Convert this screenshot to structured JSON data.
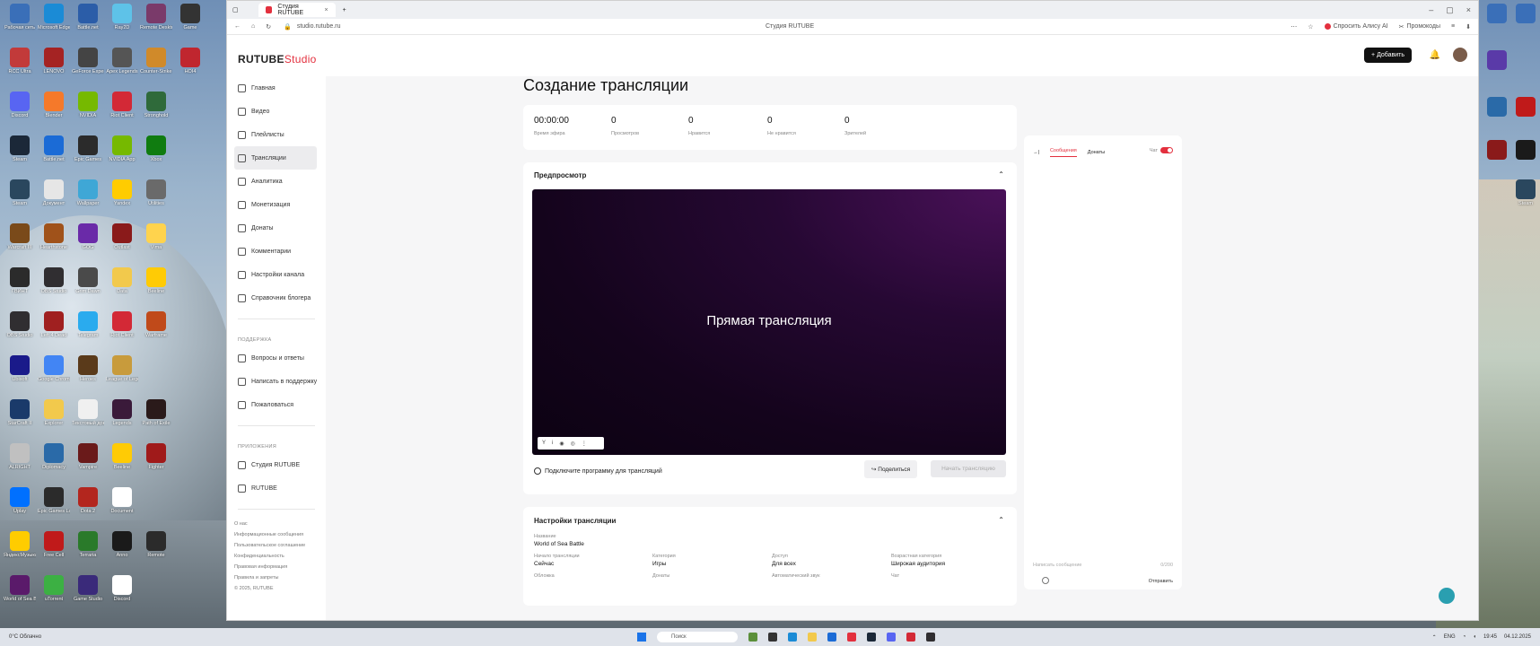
{
  "desktop": {
    "icons_left": [
      {
        "label": "Рабочая сеть",
        "color": "#3a6fb8"
      },
      {
        "label": "Microsoft Edge",
        "color": "#1b8bd6"
      },
      {
        "label": "Battle.net",
        "color": "#2b5da8"
      },
      {
        "label": "Ray2D",
        "color": "#5ec2e8"
      },
      {
        "label": "Remote Desktop",
        "color": "#7a3a6a"
      },
      {
        "label": "Game",
        "color": "#333"
      },
      {
        "label": "RCC Ultra",
        "color": "#c23a3a"
      },
      {
        "label": "LENOVO",
        "color": "#a52323"
      },
      {
        "label": "GeForce Experience",
        "color": "#444"
      },
      {
        "label": "Apex Legends",
        "color": "#555"
      },
      {
        "label": "Counter-Strike 2",
        "color": "#d08a2a"
      },
      {
        "label": "HOI4",
        "color": "#c0262f"
      },
      {
        "label": "Discord",
        "color": "#5865f2"
      },
      {
        "label": "Blender",
        "color": "#f5792a"
      },
      {
        "label": "NVIDIA",
        "color": "#76b900"
      },
      {
        "label": "Riot Client",
        "color": "#d32936"
      },
      {
        "label": "Stronghold",
        "color": "#2f6a3a"
      },
      {
        "label": "Steam",
        "color": "#1b2838"
      },
      {
        "label": "Battle.net",
        "color": "#1b6bd6"
      },
      {
        "label": "Epic Games",
        "color": "#2b2b2b"
      },
      {
        "label": "NVIDIA App",
        "color": "#76b900"
      },
      {
        "label": "Xbox",
        "color": "#107c10"
      },
      {
        "label": "Steam",
        "color": "#2a475e"
      },
      {
        "label": "Документ",
        "color": "#e6e6e6"
      },
      {
        "label": "Wallpaper",
        "color": "#3fa7d6"
      },
      {
        "label": "Yandex",
        "color": "#ffcc00"
      },
      {
        "label": "Utilities",
        "color": "#6a6a6a"
      },
      {
        "label": "Warcraft III",
        "color": "#7a4a1a"
      },
      {
        "label": "Hearthstone",
        "color": "#a0521a"
      },
      {
        "label": "GOG",
        "color": "#6a2aa8"
      },
      {
        "label": "Outlast",
        "color": "#8a1a1a"
      },
      {
        "label": "Vima",
        "color": "#ffd34d"
      },
      {
        "label": "ГВИНТ",
        "color": "#2b2b2b"
      },
      {
        "label": "OBS Studio",
        "color": "#302e31"
      },
      {
        "label": "Grim Dawn",
        "color": "#4a4a4a"
      },
      {
        "label": "Data",
        "color": "#f2c94c"
      },
      {
        "label": "Beeline",
        "color": "#ffcb05"
      },
      {
        "label": "OBS Studio",
        "color": "#302e31"
      },
      {
        "label": "Left 4 Dead",
        "color": "#a02020"
      },
      {
        "label": "Telegram",
        "color": "#2aabee"
      },
      {
        "label": "Riot Client",
        "color": "#d32936"
      },
      {
        "label": "Warframe",
        "color": "#c04a1a"
      },
      {
        "label": "Ubisoft",
        "color": "#1a1a8a"
      },
      {
        "label": "Google Chrome",
        "color": "#4285f4"
      },
      {
        "label": "Heroes",
        "color": "#5a3a1a"
      },
      {
        "label": "League of Legends",
        "color": "#c89b3c"
      },
      {
        "label": "StarCraft II",
        "color": "#1a3a6a"
      },
      {
        "label": "Explorer",
        "color": "#f2c94c"
      },
      {
        "label": "Текстовый документ",
        "color": "#f0f0f0"
      },
      {
        "label": "Legends",
        "color": "#3a1a3a"
      },
      {
        "label": "Path of Exile",
        "color": "#2a1a1a"
      },
      {
        "label": "ALRIGHT",
        "color": "#c0c0c0"
      },
      {
        "label": "Diplomacy",
        "color": "#2a6aa8"
      },
      {
        "label": "Vampire",
        "color": "#6a1a1a"
      },
      {
        "label": "Beeline",
        "color": "#ffcb05"
      },
      {
        "label": "Fighter",
        "color": "#a01a1a"
      },
      {
        "label": "Uplay",
        "color": "#0070ff"
      },
      {
        "label": "Epic Games Launcher",
        "color": "#2b2b2b"
      },
      {
        "label": "Dota 2",
        "color": "#b3261e"
      },
      {
        "label": "Document",
        "color": "#fff"
      },
      {
        "label": "ЯндексМузыка",
        "color": "#ffcc00"
      },
      {
        "label": "Free Cell",
        "color": "#c01a1a"
      },
      {
        "label": "Terraria",
        "color": "#2a7a2a"
      },
      {
        "label": "Anno",
        "color": "#1a1a1a"
      },
      {
        "label": "Remote",
        "color": "#2b2b2b"
      },
      {
        "label": "World of Sea Battle",
        "color": "#5a1a6a"
      },
      {
        "label": "uTorrent",
        "color": "#3cb043"
      },
      {
        "label": "Game Studio",
        "color": "#3a2a7a"
      },
      {
        "label": "Discord",
        "color": "#fff"
      }
    ],
    "icons_right": [
      {
        "label": "",
        "color": "#3a6fb8"
      },
      {
        "label": "",
        "color": "#5a3aa8"
      },
      {
        "label": "",
        "color": "#2a6aa8"
      },
      {
        "label": "",
        "color": "#8a1a1a"
      },
      {
        "label": "",
        "color": "#3a6fb8"
      },
      {
        "label": "",
        "color": "#c01a1a"
      },
      {
        "label": "",
        "color": "#1a1a1a"
      },
      {
        "label": "Steam",
        "color": "#2a475e"
      }
    ]
  },
  "browser": {
    "tab_title": "Студия RUTUBE",
    "url": "studio.rutube.ru",
    "page_title": "Студия RUTUBE",
    "ask_alice": "Спросить Алису AI",
    "promo": "Промокоды"
  },
  "app": {
    "logo_main": "RUTUBE",
    "logo_sub": "Studio",
    "add_label": "Добавить",
    "nav": [
      {
        "label": "Главная"
      },
      {
        "label": "Видео"
      },
      {
        "label": "Плейлисты"
      },
      {
        "label": "Трансляции",
        "active": true
      },
      {
        "label": "Аналитика"
      },
      {
        "label": "Монетизация"
      },
      {
        "label": "Донаты"
      },
      {
        "label": "Комментарии"
      },
      {
        "label": "Настройки канала"
      },
      {
        "label": "Справочник блогера"
      }
    ],
    "support_group": "ПОДДЕРЖКА",
    "support": [
      {
        "label": "Вопросы и ответы"
      },
      {
        "label": "Написать в поддержку"
      },
      {
        "label": "Пожаловаться"
      }
    ],
    "apps_group": "ПРИЛОЖЕНИЯ",
    "apps": [
      {
        "label": "Студия RUTUBE"
      },
      {
        "label": "RUTUBE"
      }
    ],
    "footer_links": [
      "О нас",
      "Информационные сообщения",
      "Пользовательское соглашение",
      "Конфиденциальность",
      "Правовая информация",
      "Правила и запреты",
      "© 2025, RUTUBE"
    ]
  },
  "main": {
    "title": "Создание трансляции",
    "stats": [
      {
        "value": "00:00:00",
        "label": "Время эфира"
      },
      {
        "value": "0",
        "label": "Просмотров"
      },
      {
        "value": "0",
        "label": "Нравится"
      },
      {
        "value": "0",
        "label": "Не нравится"
      },
      {
        "value": "0",
        "label": "Зрителей"
      }
    ],
    "preview": {
      "header": "Предпросмотр",
      "video_title": "Прямая трансляция",
      "connect_label": "Подключите программу для трансляций",
      "share_label": "Поделиться",
      "start_label": "Начать трансляцию"
    },
    "settings": {
      "header": "Настройки трансляции",
      "fields": [
        {
          "label": "Название",
          "value": "World of Sea Battle"
        },
        {
          "label": "Начало трансляции",
          "value": "Сейчас"
        },
        {
          "label": "Категория",
          "value": "Игры"
        },
        {
          "label": "Доступ",
          "value": "Для всех"
        },
        {
          "label": "Возрастная категория",
          "value": "Широкая аудитория"
        },
        {
          "label": "Обложка",
          "value": ""
        },
        {
          "label": "Донаты",
          "value": ""
        },
        {
          "label": "Автоматический звук",
          "value": ""
        },
        {
          "label": "Чат",
          "value": ""
        }
      ]
    }
  },
  "chat": {
    "tab_messages": "Сообщения",
    "tab_donations": "Донаты",
    "toggle_label": "Чат",
    "placeholder": "Написать сообщение",
    "counter": "0/200",
    "send_label": "Отправить"
  },
  "taskbar": {
    "weather_temp": "0°C",
    "weather_desc": "Облачно",
    "search": "Поиск",
    "lang": "ENG",
    "time": "19:45",
    "date": "04.12.2025"
  }
}
